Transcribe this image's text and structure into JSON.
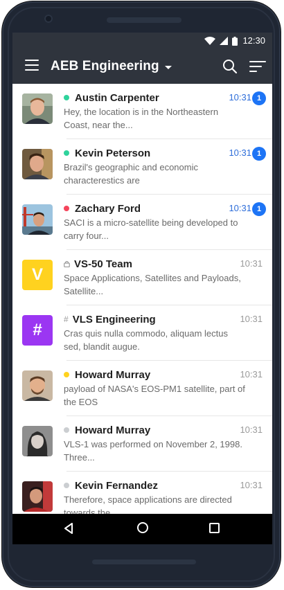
{
  "status_bar": {
    "time": "12:30",
    "icons": [
      "wifi-icon",
      "signal-icon",
      "battery-icon"
    ]
  },
  "header": {
    "title": "AEB Engineering",
    "icons": [
      "menu-icon",
      "chevron-down-icon",
      "search-icon",
      "sort-icon"
    ]
  },
  "colors": {
    "bar": "#2f343d",
    "online": "#2fd39c",
    "busy": "#f5455c",
    "away": "#ffd21f",
    "offline": "#cbced1",
    "unread": "#1d74f5"
  },
  "rooms": [
    {
      "type": "direct",
      "status": "online",
      "name": "Austin Carpenter",
      "preview": "Hey, the location is in the Northeastern Coast, near the...",
      "time": "10:31",
      "unread": "1"
    },
    {
      "type": "direct",
      "status": "online",
      "name": "Kevin Peterson",
      "preview": "Brazil's geographic and economic characterestics are",
      "time": "10:31",
      "unread": "1"
    },
    {
      "type": "direct",
      "status": "busy",
      "name": "Zachary Ford",
      "preview": "SACI is a micro-satellite being developed to carry four...",
      "time": "10:31",
      "unread": "1"
    },
    {
      "type": "private-channel",
      "avatar_letter": "V",
      "name": "VS-50 Team",
      "preview": "Space Applications, Satellites  and Payloads, Satellite...",
      "time": "10:31"
    },
    {
      "type": "channel",
      "avatar_letter": "#",
      "name": "VLS Engineering",
      "preview": "Cras quis nulla commodo, aliquam lectus sed, blandit augue.",
      "time": "10:31"
    },
    {
      "type": "direct",
      "status": "away",
      "name": "Howard Murray",
      "preview": "payload of NASA's EOS-PM1 satellite, part of the EOS",
      "time": "10:31"
    },
    {
      "type": "direct",
      "status": "offline",
      "name": "Howard Murray",
      "preview": "VLS-1 was performed on November 2, 1998. Three...",
      "time": "10:31"
    },
    {
      "type": "direct",
      "status": "offline",
      "name": "Kevin Fernandez",
      "preview": "Therefore, space applications are directed towards the...",
      "time": "10:31"
    }
  ]
}
